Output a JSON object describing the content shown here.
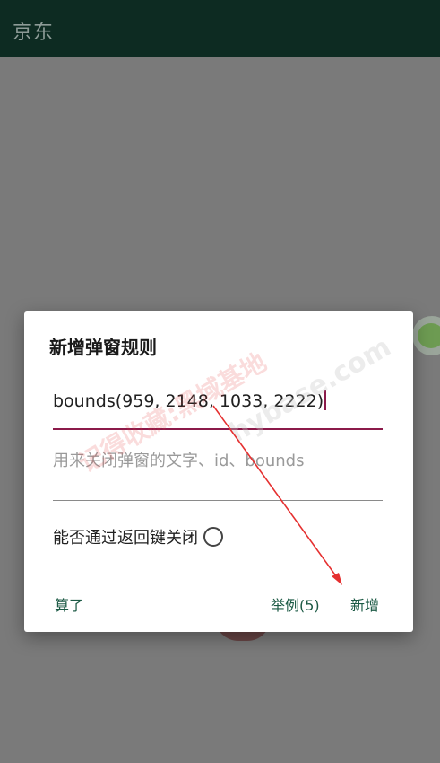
{
  "appbar": {
    "title": "京东"
  },
  "dialog": {
    "title": "新增弹窗规则",
    "rule_input_value": "bounds(959, 2148, 1033, 2222)",
    "text_input_placeholder": "用来关闭弹窗的文字、id、bounds",
    "back_close_label": "能否通过返回键关闭",
    "back_close_checked": false,
    "cancel_label": "算了",
    "examples_label": "举例(5)",
    "add_label": "新增"
  },
  "colors": {
    "appbar": "#0d2b22",
    "scrim": "#7a7a7a",
    "accent_underline": "#8b1a4a",
    "button_text": "#1c5a45",
    "annotation_arrow": "#e53030"
  },
  "watermark": {
    "text": "记得收藏:黑域基地",
    "text2": "hybase.com"
  }
}
